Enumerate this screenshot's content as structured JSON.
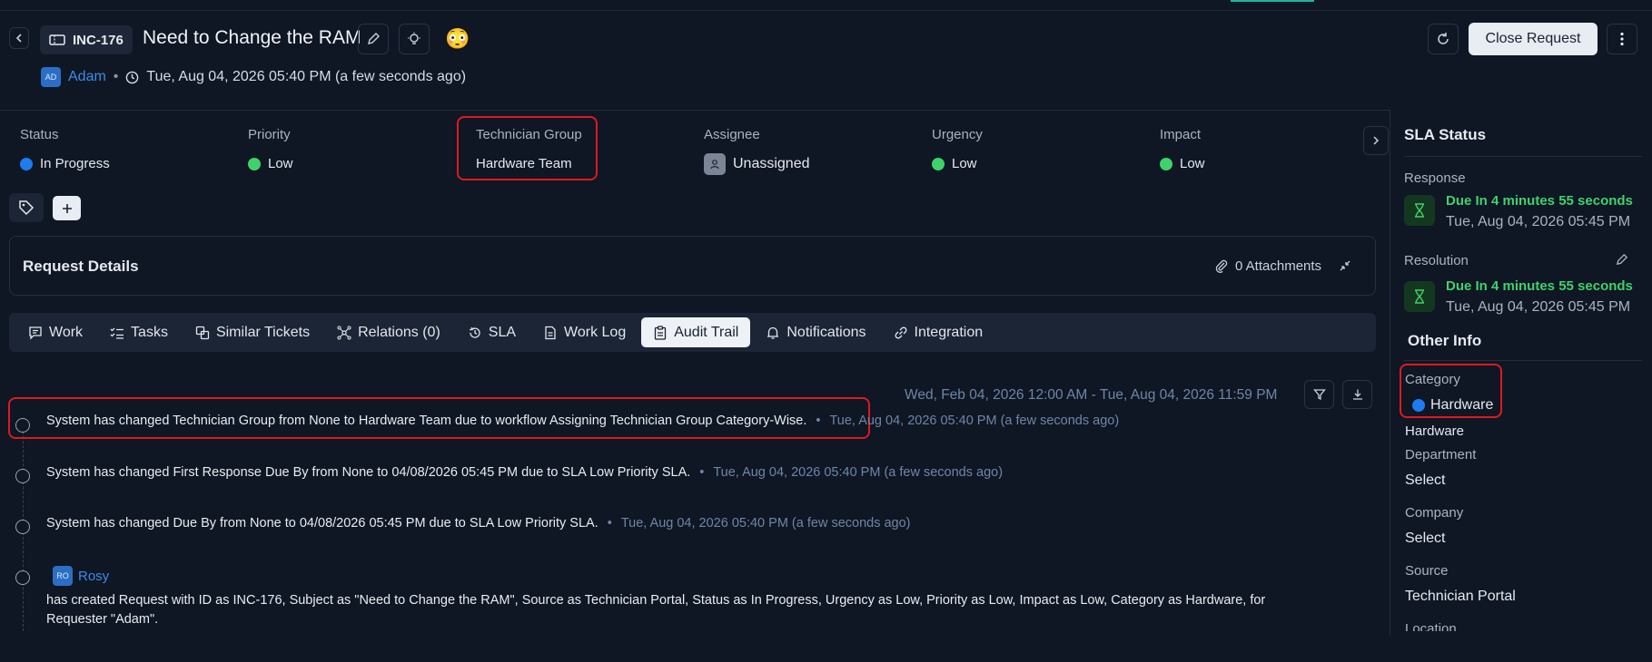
{
  "header": {
    "ticket_id": "INC-176",
    "title": "Need to Change the RAM",
    "emoji": "😳",
    "requester_initials": "AD",
    "requester": "Adam",
    "created": "Tue, Aug 04, 2026 05:40 PM (a few seconds ago)",
    "close_label": "Close Request"
  },
  "fields": {
    "status_label": "Status",
    "status_value": "In Progress",
    "priority_label": "Priority",
    "priority_value": "Low",
    "tech_group_label": "Technician Group",
    "tech_group_value": "Hardware Team",
    "assignee_label": "Assignee",
    "assignee_value": "Unassigned",
    "urgency_label": "Urgency",
    "urgency_value": "Low",
    "impact_label": "Impact",
    "impact_value": "Low"
  },
  "details": {
    "title": "Request Details",
    "attachments": "0 Attachments"
  },
  "tabs": [
    "Work",
    "Tasks",
    "Similar Tickets",
    "Relations (0)",
    "SLA",
    "Work Log",
    "Audit Trail",
    "Notifications",
    "Integration"
  ],
  "audit": {
    "range": "Wed, Feb 04, 2026 12:00 AM - Tue, Aug 04, 2026 11:59 PM",
    "entries": [
      {
        "text": "System has changed Technician Group from None to Hardware Team due to workflow Assigning Technician Group Category-Wise.",
        "time": "Tue, Aug 04, 2026 05:40 PM (a few seconds ago)"
      },
      {
        "text": "System has changed First Response Due By from None to 04/08/2026 05:45 PM due to SLA Low Priority SLA.",
        "time": "Tue, Aug 04, 2026 05:40 PM (a few seconds ago)"
      },
      {
        "text": "System has changed Due By from None to 04/08/2026 05:45 PM due to SLA Low Priority SLA.",
        "time": "Tue, Aug 04, 2026 05:40 PM (a few seconds ago)"
      }
    ],
    "creator_initials": "RO",
    "creator": "Rosy",
    "created_line1": "has created Request with ID as INC-176, Subject as \"Need to Change the RAM\", Source as Technician Portal, Status as In Progress, Urgency as Low, Priority as Low, Impact as Low, Category as Hardware, for",
    "created_line2": "Requester \"Adam\"."
  },
  "sla": {
    "title": "SLA Status",
    "response_label": "Response",
    "response_due": "Due In 4 minutes 55 seconds",
    "response_date": "Tue, Aug 04, 2026 05:45 PM",
    "resolution_label": "Resolution",
    "resolution_due": "Due In 4 minutes 55 seconds",
    "resolution_date": "Tue, Aug 04, 2026 05:45 PM"
  },
  "other": {
    "title": "Other Info",
    "category_label": "Category",
    "category_value": "Hardware",
    "category_sub": "Hardware",
    "department_label": "Department",
    "department_value": "Select",
    "company_label": "Company",
    "company_value": "Select",
    "source_label": "Source",
    "source_value": "Technician Portal",
    "location_label": "Location"
  },
  "colors": {
    "accent_green": "#3fd26b",
    "status_blue": "#1e7bf0",
    "highlight_red": "#e0191f",
    "link_blue": "#3b8de8"
  },
  "icons": [
    "back-icon",
    "ticket-icon",
    "edit-icon",
    "bulb-icon",
    "refresh-icon",
    "kebab-icon",
    "clock-icon",
    "tag-icon",
    "plus-icon",
    "paperclip-icon",
    "collapse-icon",
    "filter-icon",
    "download-icon",
    "hourglass-icon",
    "chevron-right-icon"
  ]
}
